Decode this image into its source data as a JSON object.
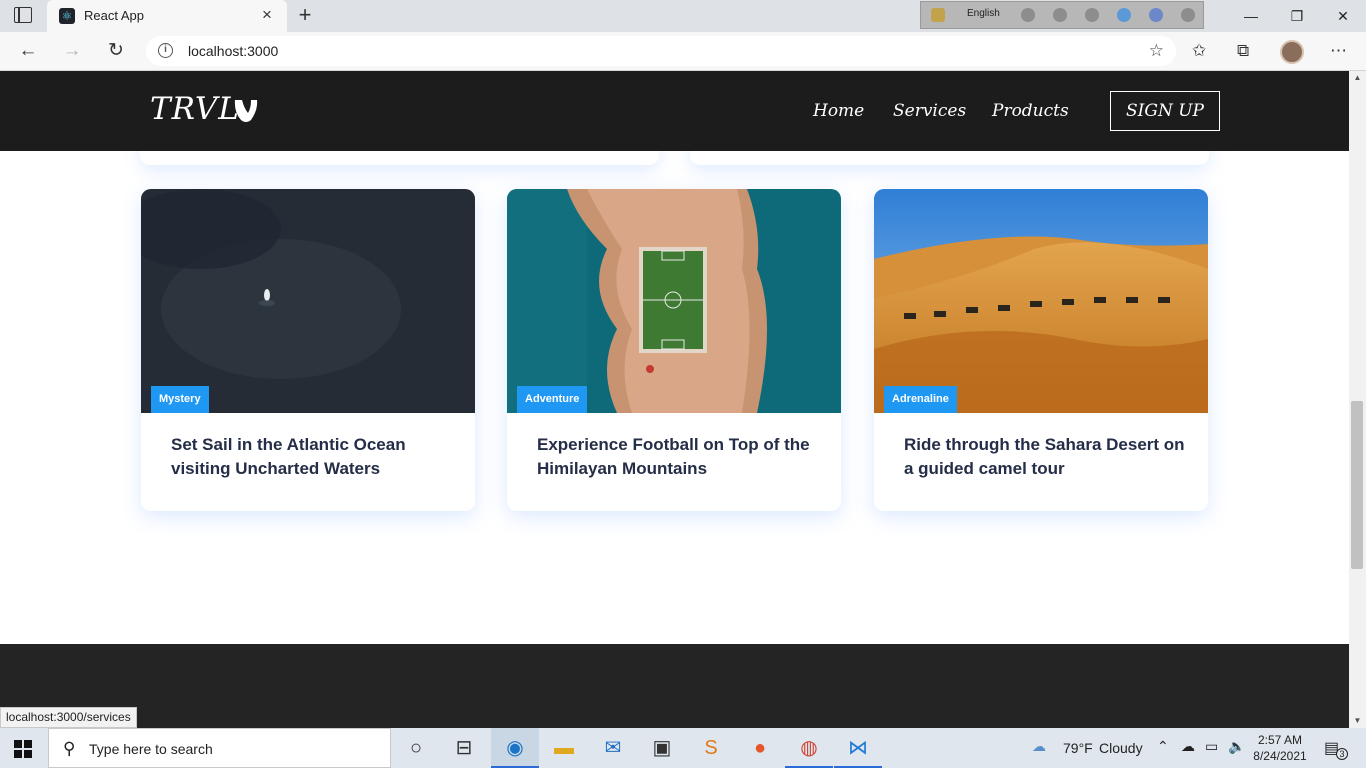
{
  "browser": {
    "tab_title": "React App",
    "tab_favicon": "react-icon",
    "new_tab": "+",
    "close_tab": "×",
    "extension_language": "English",
    "url": "localhost:3000",
    "status_url": "localhost:3000/services",
    "window_controls": {
      "minimize": "—",
      "restore": "❐",
      "close": "✕"
    }
  },
  "site": {
    "logo_text": "TRVL",
    "nav": {
      "home": "Home",
      "services": "Services",
      "products": "Products",
      "signup": "SIGN UP"
    }
  },
  "cards": [
    {
      "label": "Mystery",
      "title": "Set Sail in the Atlantic Ocean visiting Uncharted Waters",
      "image": "ocean-boat-aerial"
    },
    {
      "label": "Adventure",
      "title": "Experience Football on Top of the Himilayan Mountains",
      "image": "island-football-field"
    },
    {
      "label": "Adrenaline",
      "title": "Ride through the Sahara Desert on a guided camel tour",
      "image": "desert-camels"
    }
  ],
  "colors": {
    "nav_bg": "#1c1c1c",
    "badge_bg": "#1f98f4",
    "card_title": "#252e48",
    "footer_bg": "#242424"
  },
  "taskbar": {
    "search_placeholder": "Type here to search",
    "weather_temp": "79°F",
    "weather_desc": "Cloudy",
    "time": "2:57 AM",
    "date": "8/24/2021",
    "notification_count": "3"
  }
}
